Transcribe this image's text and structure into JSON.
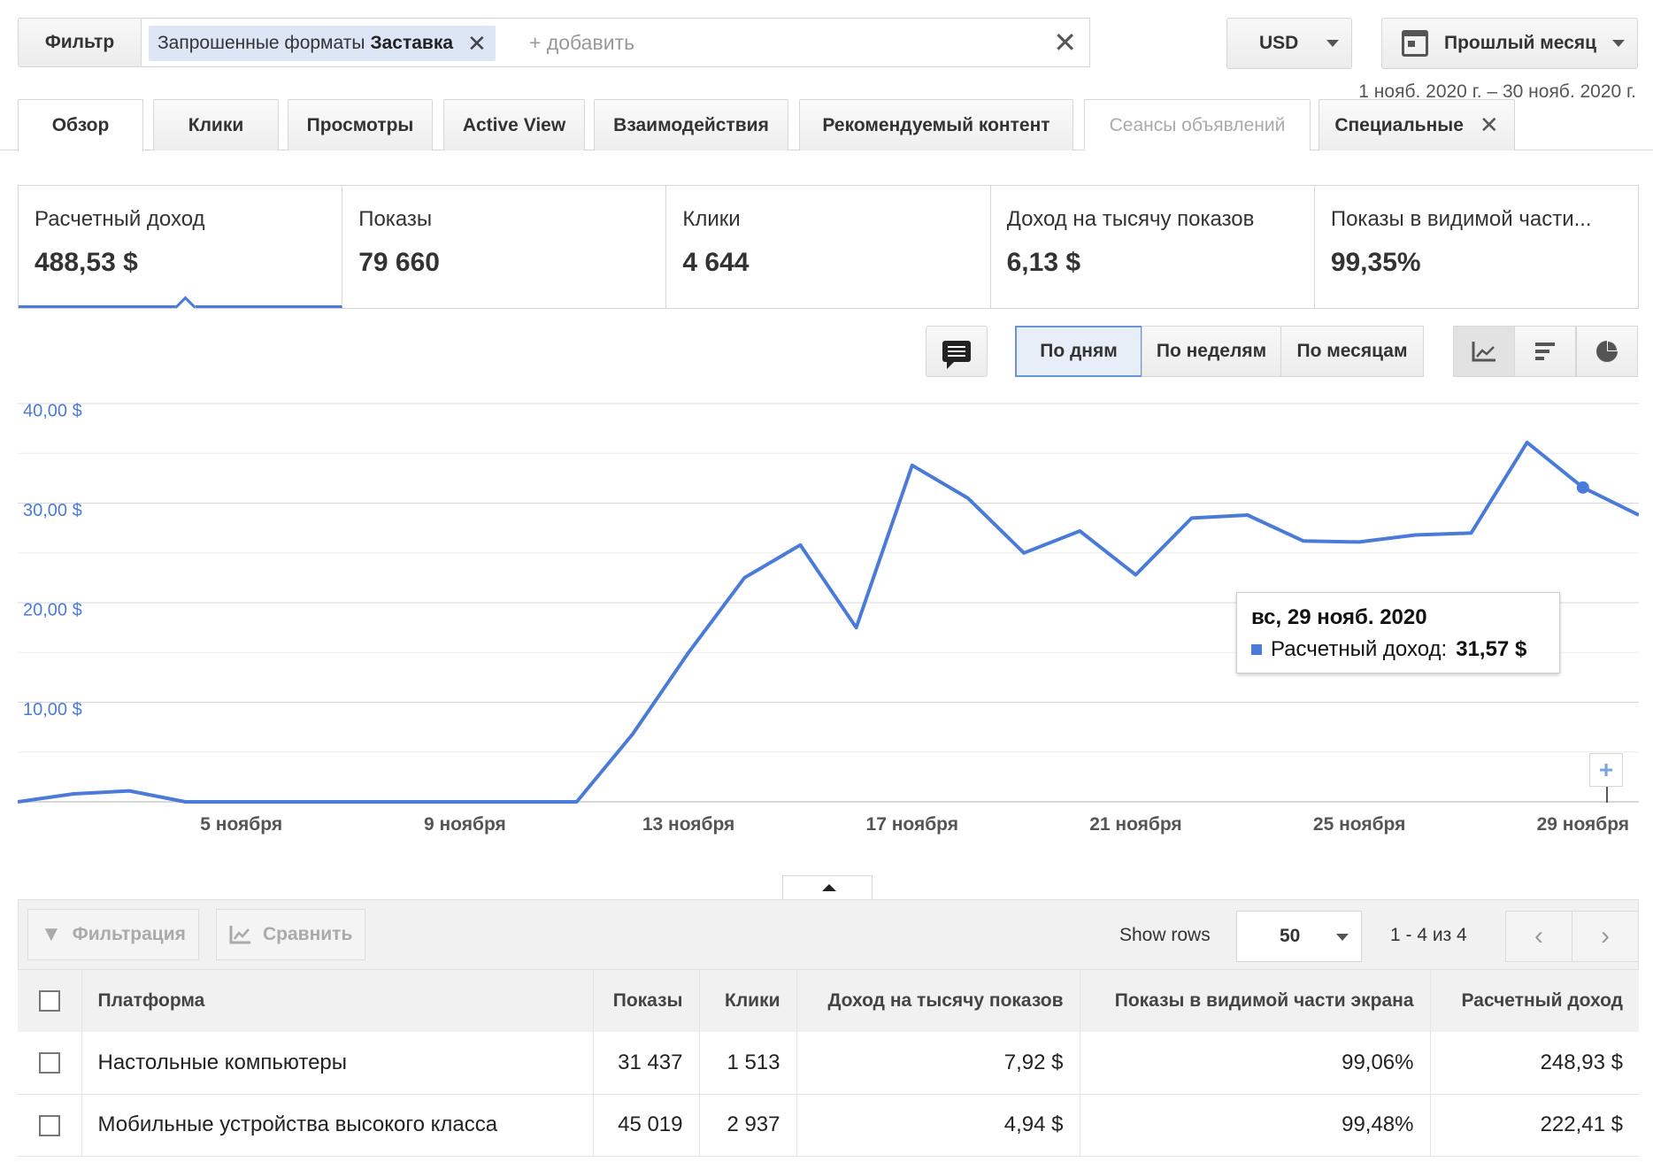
{
  "filter": {
    "button_label": "Фильтр",
    "chip_label": "Запрошенные форматы",
    "chip_value": "Заставка",
    "add_placeholder": "+ добавить"
  },
  "currency": "USD",
  "period": {
    "label": "Прошлый месяц",
    "range": "1 нояб. 2020 г. – 30 нояб. 2020 г."
  },
  "tabs": [
    {
      "label": "Обзор"
    },
    {
      "label": "Клики"
    },
    {
      "label": "Просмотры"
    },
    {
      "label": "Active View"
    },
    {
      "label": "Взаимодействия"
    },
    {
      "label": "Рекомендуемый контент"
    },
    {
      "label": "Сеансы объявлений"
    },
    {
      "label": "Специальные"
    }
  ],
  "metrics": [
    {
      "label": "Расчетный доход",
      "value": "488,53 $"
    },
    {
      "label": "Показы",
      "value": "79 660"
    },
    {
      "label": "Клики",
      "value": "4 644"
    },
    {
      "label": "Доход на тысячу показов",
      "value": "6,13 $"
    },
    {
      "label": "Показы в видимой части...",
      "value": "99,35%"
    }
  ],
  "granularity": {
    "day": "По дням",
    "week": "По неделям",
    "month": "По месяцам"
  },
  "chart_data": {
    "type": "line",
    "ylim": [
      0,
      40
    ],
    "y_ticks": [
      "40,00 $",
      "30,00 $",
      "20,00 $",
      "10,00 $"
    ],
    "x_ticks": [
      "5 ноября",
      "9 ноября",
      "13 ноября",
      "17 ноября",
      "21 ноября",
      "25 ноября",
      "29 ноября"
    ],
    "x_tick_days": [
      5,
      9,
      13,
      17,
      21,
      25,
      29
    ],
    "x": [
      1,
      2,
      3,
      4,
      5,
      6,
      7,
      8,
      9,
      10,
      11,
      12,
      13,
      14,
      15,
      16,
      17,
      18,
      19,
      20,
      21,
      22,
      23,
      24,
      25,
      26,
      27,
      28,
      29,
      30
    ],
    "series": [
      {
        "name": "Расчетный доход",
        "color": "#4a7bd8",
        "values": [
          0.0,
          0.8,
          1.1,
          0.0,
          0.0,
          0.0,
          0.0,
          0.0,
          0.0,
          0.0,
          0.0,
          6.8,
          15.0,
          22.5,
          25.8,
          17.5,
          33.8,
          30.5,
          25.0,
          27.2,
          22.8,
          28.5,
          28.8,
          26.2,
          26.1,
          26.8,
          27.0,
          36.1,
          31.57,
          28.8
        ]
      }
    ],
    "grid": true,
    "highlight_index": 28
  },
  "tooltip": {
    "date": "вс, 29 нояб. 2020",
    "label": "Расчетный доход:",
    "value": "31,57 $"
  },
  "table_toolbar": {
    "filter": "Фильтрация",
    "compare": "Сравнить",
    "show_rows": "Show rows",
    "rows": "50",
    "pagination": "1 - 4 из 4"
  },
  "table": {
    "headers": [
      "Платформа",
      "Показы",
      "Клики",
      "Доход на тысячу показов",
      "Показы в видимой части экрана",
      "Расчетный доход"
    ],
    "rows": [
      [
        "Настольные компьютеры",
        "31 437",
        "1 513",
        "7,92 $",
        "99,06%",
        "248,93 $"
      ],
      [
        "Мобильные устройства высокого класса",
        "45 019",
        "2 937",
        "4,94 $",
        "99,48%",
        "222,41 $"
      ]
    ]
  }
}
